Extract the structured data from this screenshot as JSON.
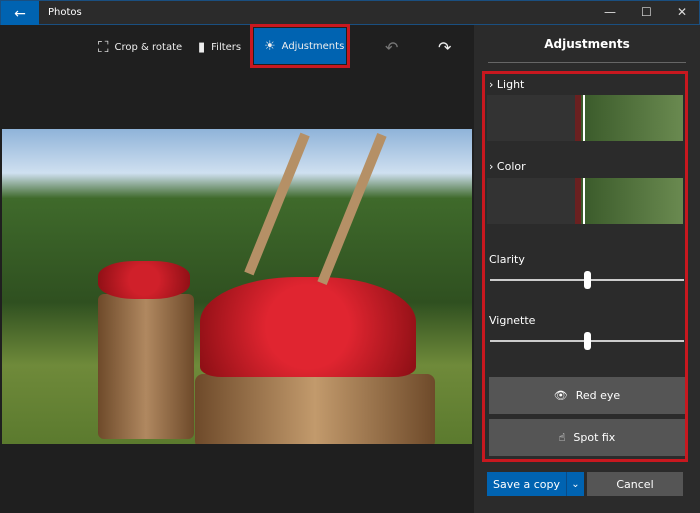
{
  "window": {
    "title": "Photos",
    "minimize": "—",
    "maximize": "☐",
    "close": "✕"
  },
  "toolbar": {
    "crop": "Crop & rotate",
    "filters": "Filters",
    "adjustments": "Adjustments"
  },
  "panel": {
    "title": "Adjustments",
    "light": "Light",
    "color": "Color",
    "clarity": "Clarity",
    "vignette": "Vignette",
    "red_eye": "Red eye",
    "spot_fix": "Spot fix",
    "save": "Save a copy",
    "cancel": "Cancel",
    "clarity_value": 0.5,
    "vignette_value": 0.5
  },
  "colors": {
    "accent": "#0063b1",
    "highlight": "#c8181f"
  }
}
